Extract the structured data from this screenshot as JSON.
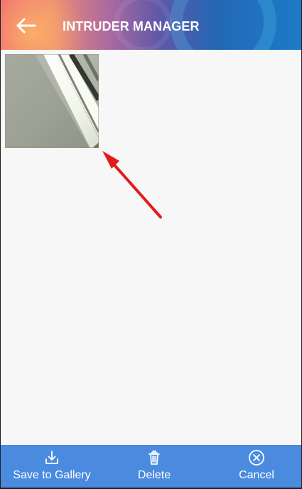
{
  "header": {
    "title": "INTRUDER MANAGER",
    "back_icon": "arrow-left-icon"
  },
  "gallery": {
    "items": [
      {
        "image_type": "intruder-photo"
      }
    ]
  },
  "annotation": {
    "arrow_color": "#e31b1b"
  },
  "actions": [
    {
      "label": "Save to Gallery",
      "icon": "download-icon"
    },
    {
      "label": "Delete",
      "icon": "trash-icon"
    },
    {
      "label": "Cancel",
      "icon": "close-circle-icon"
    }
  ],
  "colors": {
    "bottom_bar": "#4a8be0",
    "background": "#f7f7f7"
  }
}
